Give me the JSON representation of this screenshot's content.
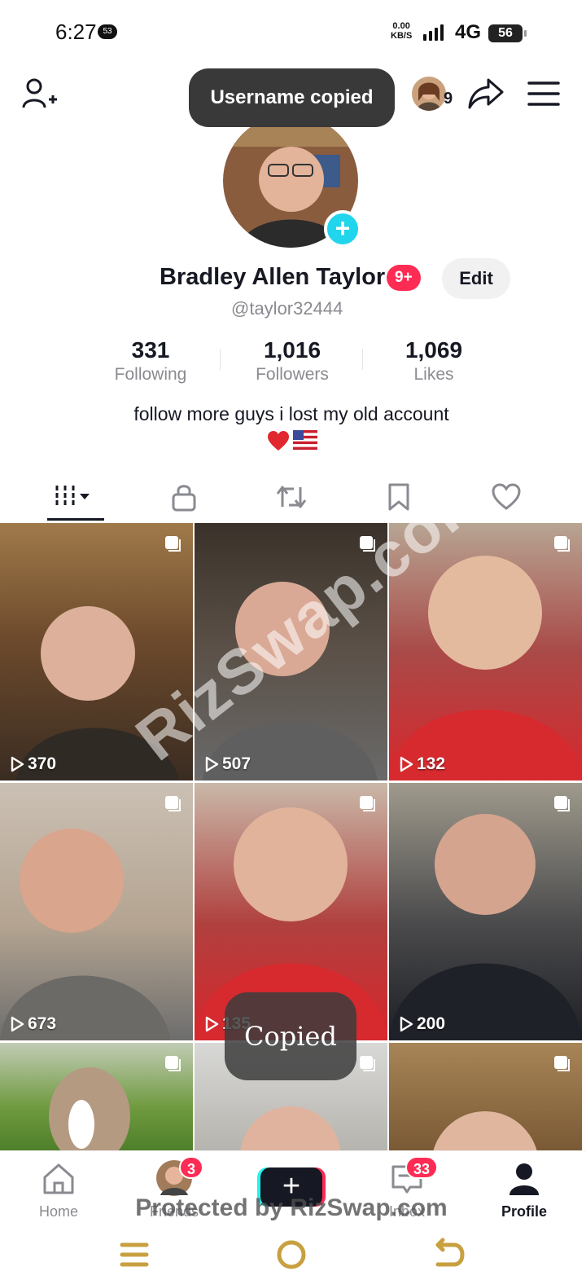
{
  "status_bar": {
    "time": "6:27",
    "notification_badge": "53",
    "net_speed_value": "0.00",
    "net_speed_unit": "KB/S",
    "network": "4G",
    "battery": "56"
  },
  "header": {
    "story_count": "9",
    "toast": "Username copied"
  },
  "profile": {
    "display_name": "Bradley Allen Taylor",
    "name_badge": "9+",
    "edit_label": "Edit",
    "username": "@taylor32444",
    "stats": [
      {
        "value": "331",
        "label": "Following"
      },
      {
        "value": "1,016",
        "label": "Followers"
      },
      {
        "value": "1,069",
        "label": "Likes"
      }
    ],
    "bio": "follow more guys i lost my old account",
    "bio_emoji": [
      "heart",
      "us-flag"
    ]
  },
  "tabs": [
    {
      "name": "videos",
      "icon": "grid-icon",
      "active": true
    },
    {
      "name": "private",
      "icon": "lock-icon",
      "active": false
    },
    {
      "name": "reposts",
      "icon": "repost-icon",
      "active": false
    },
    {
      "name": "favorites",
      "icon": "bookmark-icon",
      "active": false
    },
    {
      "name": "liked",
      "icon": "heart-icon",
      "active": false
    }
  ],
  "videos": [
    {
      "views": "370"
    },
    {
      "views": "507"
    },
    {
      "views": "132"
    },
    {
      "views": "673"
    },
    {
      "views": "135"
    },
    {
      "views": "200"
    },
    {
      "views": ""
    },
    {
      "views": ""
    },
    {
      "views": ""
    }
  ],
  "overlays": {
    "copied_toast": "Copied",
    "watermark": "RizSwap.com",
    "protected_banner": "Protected by RizSwap.com"
  },
  "bottom_nav": {
    "items": [
      {
        "label": "Home"
      },
      {
        "label": "Friends",
        "badge": "3"
      },
      {
        "label": ""
      },
      {
        "label": "Inbox",
        "badge": "33"
      },
      {
        "label": "Profile"
      }
    ]
  },
  "colors": {
    "accent_red": "#fe2c55",
    "accent_cyan": "#20d5ec",
    "text_primary": "#161823",
    "text_secondary": "#8a8b91"
  }
}
